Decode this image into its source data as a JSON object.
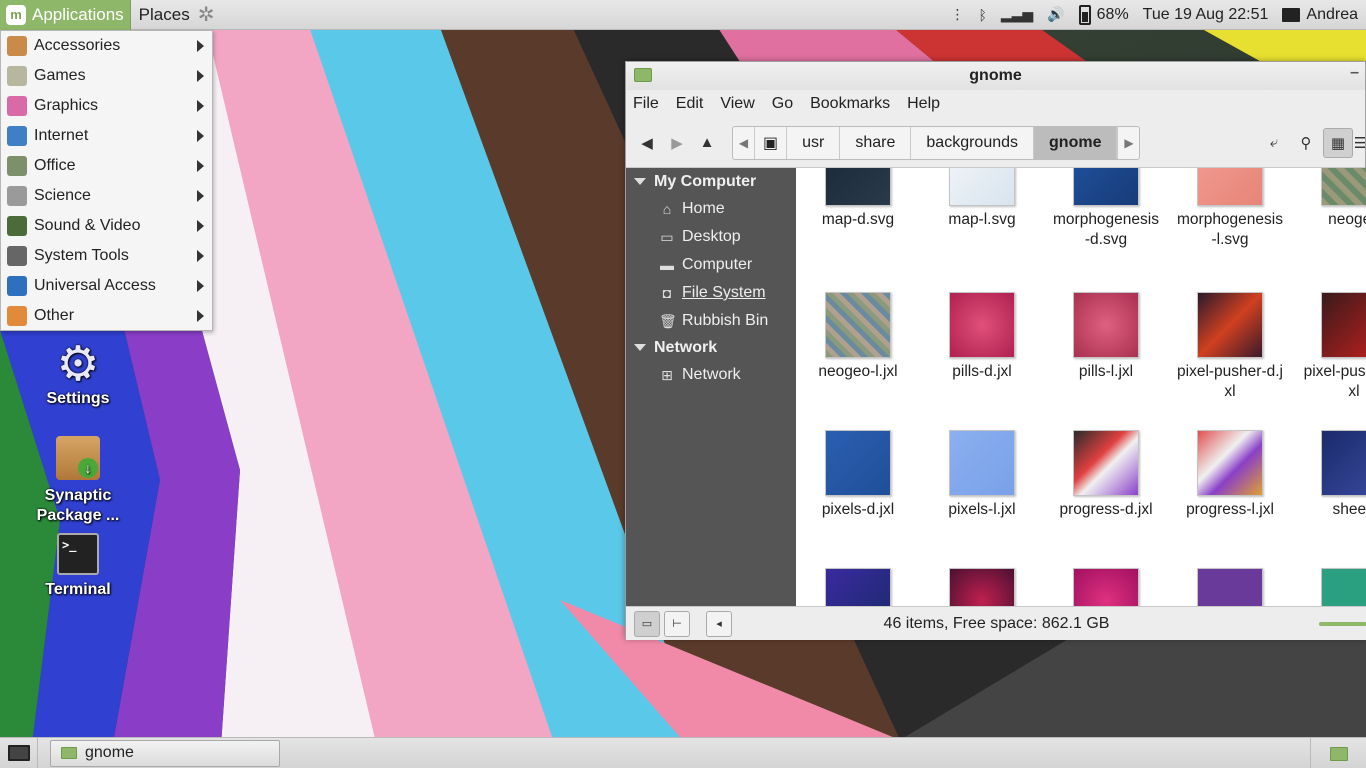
{
  "top_panel": {
    "applications_label": "Applications",
    "places_label": "Places",
    "battery_text": "68%",
    "datetime": "Tue 19 Aug  22:51",
    "user_name": "Andrea"
  },
  "app_menu": {
    "items": [
      {
        "label": "Accessories",
        "icon": "accessories-icon",
        "color": "#c98a4a"
      },
      {
        "label": "Games",
        "icon": "games-icon",
        "color": "#b7b7a0"
      },
      {
        "label": "Graphics",
        "icon": "graphics-icon",
        "color": "#d96aa7"
      },
      {
        "label": "Internet",
        "icon": "internet-icon",
        "color": "#3f7fc6"
      },
      {
        "label": "Office",
        "icon": "office-icon",
        "color": "#7d8f6b"
      },
      {
        "label": "Science",
        "icon": "science-icon",
        "color": "#9a9a9a"
      },
      {
        "label": "Sound & Video",
        "icon": "sound-video-icon",
        "color": "#4c6b3a"
      },
      {
        "label": "System Tools",
        "icon": "system-tools-icon",
        "color": "#666666"
      },
      {
        "label": "Universal Access",
        "icon": "universal-access-icon",
        "color": "#2f6fbf"
      },
      {
        "label": "Other",
        "icon": "other-icon",
        "color": "#e08a3a"
      }
    ]
  },
  "desktop": {
    "settings_label": "Settings",
    "synaptic_label": "Synaptic Package ...",
    "terminal_label": "Terminal"
  },
  "file_manager": {
    "title": "gnome",
    "menu": [
      "File",
      "Edit",
      "View",
      "Go",
      "Bookmarks",
      "Help"
    ],
    "path": [
      "usr",
      "share",
      "backgrounds",
      "gnome"
    ],
    "sidebar": {
      "my_computer": "My Computer",
      "items": [
        "Home",
        "Desktop",
        "Computer",
        "File System",
        "Rubbish Bin"
      ],
      "network_header": "Network",
      "network_items": [
        "Network"
      ]
    },
    "files": [
      "map-d.svg",
      "map-l.svg",
      "morphogenesis-d.svg",
      "morphogenesis-l.svg",
      "neogeo",
      "neogeo-l.jxl",
      "pills-d.jxl",
      "pills-l.jxl",
      "pixel-pusher-d.jxl",
      "pixel-pusher-l.jxl",
      "pixels-d.jxl",
      "pixels-l.jxl",
      "progress-d.jxl",
      "progress-l.jxl",
      "sheet-"
    ],
    "status": "46 items, Free space: 862.1 GB"
  },
  "bottom_panel": {
    "task_label": "gnome"
  }
}
